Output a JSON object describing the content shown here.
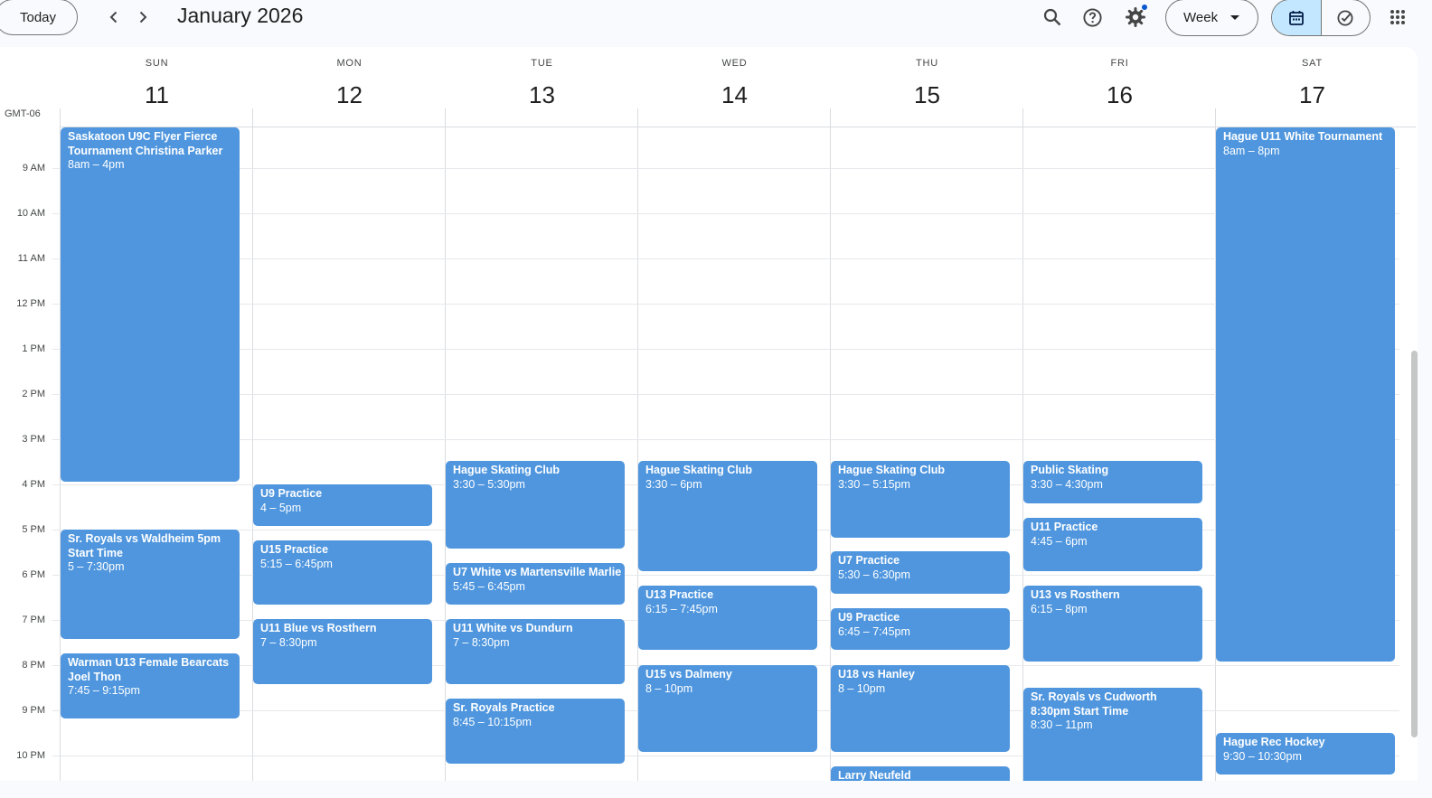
{
  "toolbar": {
    "today_label": "Today",
    "prev_icon": "chevron-left-icon",
    "next_icon": "chevron-right-icon",
    "period_label": "January 2026",
    "icons": [
      "search-icon",
      "help-icon",
      "gear-icon",
      "apps-grid-icon"
    ],
    "view_label": "Week",
    "calendar_toggle_icon": "calendar-icon",
    "tasks_toggle_icon": "check-circle-icon"
  },
  "timezone": "GMT-06",
  "days": [
    {
      "dow": "SUN",
      "num": "11"
    },
    {
      "dow": "MON",
      "num": "12"
    },
    {
      "dow": "TUE",
      "num": "13"
    },
    {
      "dow": "WED",
      "num": "14"
    },
    {
      "dow": "THU",
      "num": "15"
    },
    {
      "dow": "FRI",
      "num": "16"
    },
    {
      "dow": "SAT",
      "num": "17"
    }
  ],
  "hours": [
    "9 AM",
    "10 AM",
    "11 AM",
    "12 PM",
    "1 PM",
    "2 PM",
    "3 PM",
    "4 PM",
    "5 PM",
    "6 PM",
    "7 PM",
    "8 PM",
    "9 PM",
    "10 PM"
  ],
  "colors": {
    "event": "#4f96de",
    "background": "#f8fafd",
    "surface": "#ffffff",
    "accent": "#0b57d0",
    "selected_toggle": "#c2e7ff"
  },
  "events": [
    {
      "title": "Saskatoon U9C Flyer Fierce Tournament Christina Parker",
      "time": "8am – 4pm"
    },
    {
      "title": "Sr. Royals vs Waldheim 5pm Start Time",
      "time": "5 – 7:30pm"
    },
    {
      "title": "Warman U13 Female Bearcats Joel Thon",
      "time": "7:45 – 9:15pm"
    },
    {
      "title": "U9 Practice",
      "time": "4 – 5pm"
    },
    {
      "title": "U15 Practice",
      "time": "5:15 – 6:45pm"
    },
    {
      "title": "U11 Blue vs Rosthern",
      "time": "7 – 8:30pm"
    },
    {
      "title": "Hague Skating Club",
      "time": "3:30 – 5:30pm"
    },
    {
      "title": "U7 White vs Martensville Marlie",
      "time": "5:45 – 6:45pm"
    },
    {
      "title": "U11 White vs Dundurn",
      "time": "7 – 8:30pm"
    },
    {
      "title": "Sr. Royals Practice",
      "time": "8:45 – 10:15pm"
    },
    {
      "title": "Hague Skating Club",
      "time": "3:30 – 6pm"
    },
    {
      "title": "U13 Practice",
      "time": "6:15 – 7:45pm"
    },
    {
      "title": "U15 vs Dalmeny",
      "time": "8 – 10pm"
    },
    {
      "title": "Hague Skating Club",
      "time": "3:30 – 5:15pm"
    },
    {
      "title": "U7 Practice",
      "time": "5:30 – 6:30pm"
    },
    {
      "title": "U9 Practice",
      "time": "6:45 – 7:45pm"
    },
    {
      "title": "U18 vs Hanley",
      "time": "8 – 10pm"
    },
    {
      "title": "Larry Neufeld",
      "time": ""
    },
    {
      "title": "Public Skating",
      "time": "3:30 – 4:30pm"
    },
    {
      "title": "U11 Practice",
      "time": "4:45 – 6pm"
    },
    {
      "title": "U13 vs Rosthern",
      "time": "6:15 – 8pm"
    },
    {
      "title": "Sr. Royals vs Cudworth 8:30pm Start Time",
      "time": "8:30 – 11pm"
    },
    {
      "title": "Hague U11 White Tournament",
      "time": "8am – 8pm"
    },
    {
      "title": "Hague Rec Hockey",
      "time": "9:30 – 10:30pm"
    }
  ]
}
